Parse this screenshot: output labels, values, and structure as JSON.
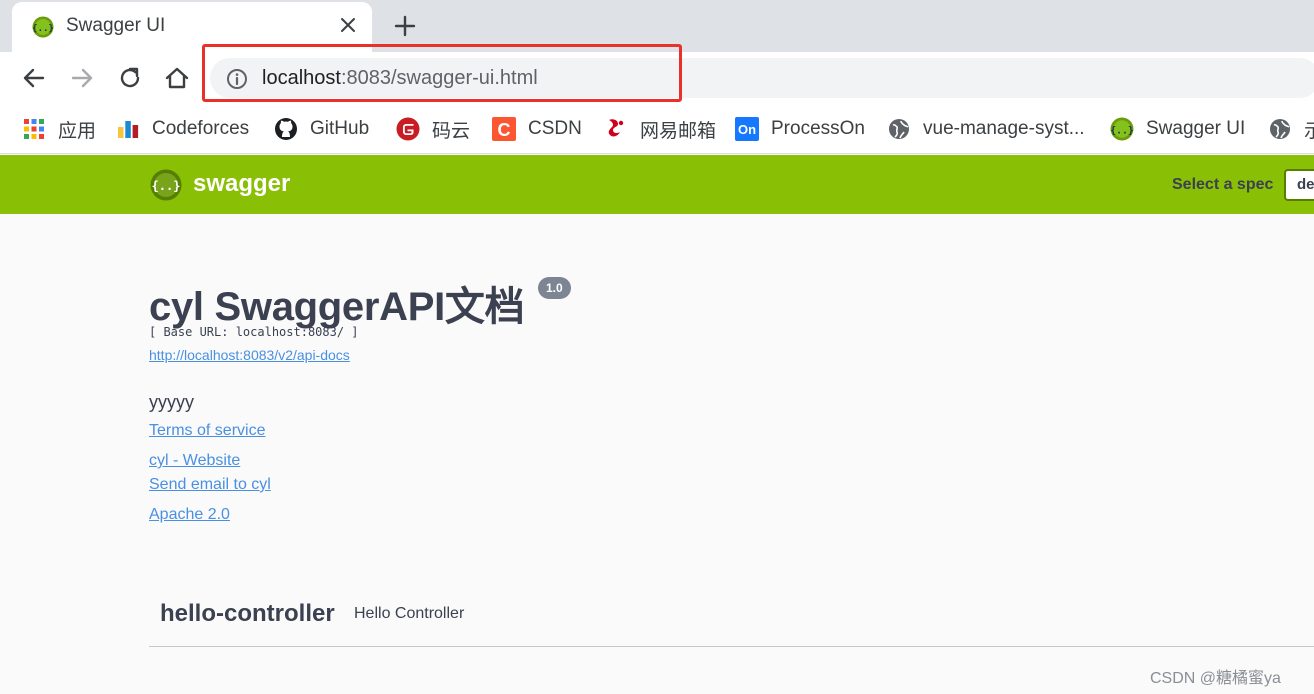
{
  "browser": {
    "tab": {
      "title": "Swagger UI",
      "favicon": "swagger-icon"
    },
    "toolbar": {
      "back": "back-icon",
      "forward": "forward-icon",
      "reload": "reload-icon",
      "home": "home-icon"
    },
    "address": {
      "host": "localhost",
      "rest": ":8083/swagger-ui.html"
    },
    "bookmarks": [
      {
        "label": "应用",
        "icon": "apps-grid-icon"
      },
      {
        "label": "Codeforces",
        "icon": "codeforces-icon"
      },
      {
        "label": "GitHub",
        "icon": "github-icon"
      },
      {
        "label": "码云",
        "icon": "gitee-icon"
      },
      {
        "label": "CSDN",
        "icon": "csdn-icon"
      },
      {
        "label": "网易邮箱",
        "icon": "netease-mail-icon"
      },
      {
        "label": "ProcessOn",
        "icon": "processon-icon"
      },
      {
        "label": "vue-manage-syst...",
        "icon": "globe-icon"
      },
      {
        "label": "Swagger UI",
        "icon": "swagger-icon"
      },
      {
        "label": "示",
        "icon": "globe-icon"
      }
    ]
  },
  "swagger": {
    "logo_text": "swagger",
    "select_label": "Select a spec",
    "select_value": "default",
    "title": "cyl SwaggerAPI文档",
    "version": "1.0",
    "base_url": "[ Base URL: localhost:8083/ ]",
    "spec_url": "http://localhost:8083/v2/api-docs",
    "description": "yyyyy",
    "terms": "Terms of service",
    "website": "cyl - Website",
    "email": "Send email to cyl",
    "license": "Apache 2.0",
    "controller": {
      "name": "hello-controller",
      "description": "Hello Controller"
    }
  },
  "watermark": "CSDN @糖橘蜜ya",
  "colors": {
    "swagger_green": "#89bf04",
    "link": "#4990e2",
    "highlight": "#e8312a"
  }
}
